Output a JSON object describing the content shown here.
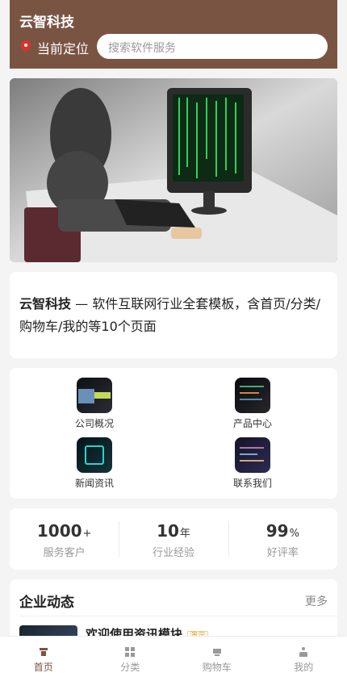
{
  "header": {
    "brand": "云智科技",
    "location_label": "当前定位",
    "search_placeholder": "搜索软件服务"
  },
  "intro": {
    "brand": "云智科技",
    "text": " — 软件互联网行业全套模板，含首页/分类/购物车/我的等10个页面"
  },
  "menu": [
    {
      "label": "公司概况",
      "icon": "company-icon"
    },
    {
      "label": "产品中心",
      "icon": "product-icon"
    },
    {
      "label": "新闻资讯",
      "icon": "news-icon"
    },
    {
      "label": "联系我们",
      "icon": "contact-icon"
    }
  ],
  "stats": [
    {
      "value": "1000",
      "unit": "+",
      "label": "服务客户"
    },
    {
      "value": "10",
      "unit": "年",
      "label": "行业经验"
    },
    {
      "value": "99",
      "unit": "%",
      "label": "好评率"
    }
  ],
  "news": {
    "title": "企业动态",
    "more": "更多",
    "items": [
      {
        "title": "欢迎使用资讯模块",
        "tag": "演示"
      }
    ]
  },
  "tabbar": [
    {
      "label": "首页",
      "active": true
    },
    {
      "label": "分类",
      "active": false
    },
    {
      "label": "购物车",
      "active": false
    },
    {
      "label": "我的",
      "active": false
    }
  ],
  "colors": {
    "brand": "#7a5443",
    "accent_tag": "#e09a15"
  }
}
